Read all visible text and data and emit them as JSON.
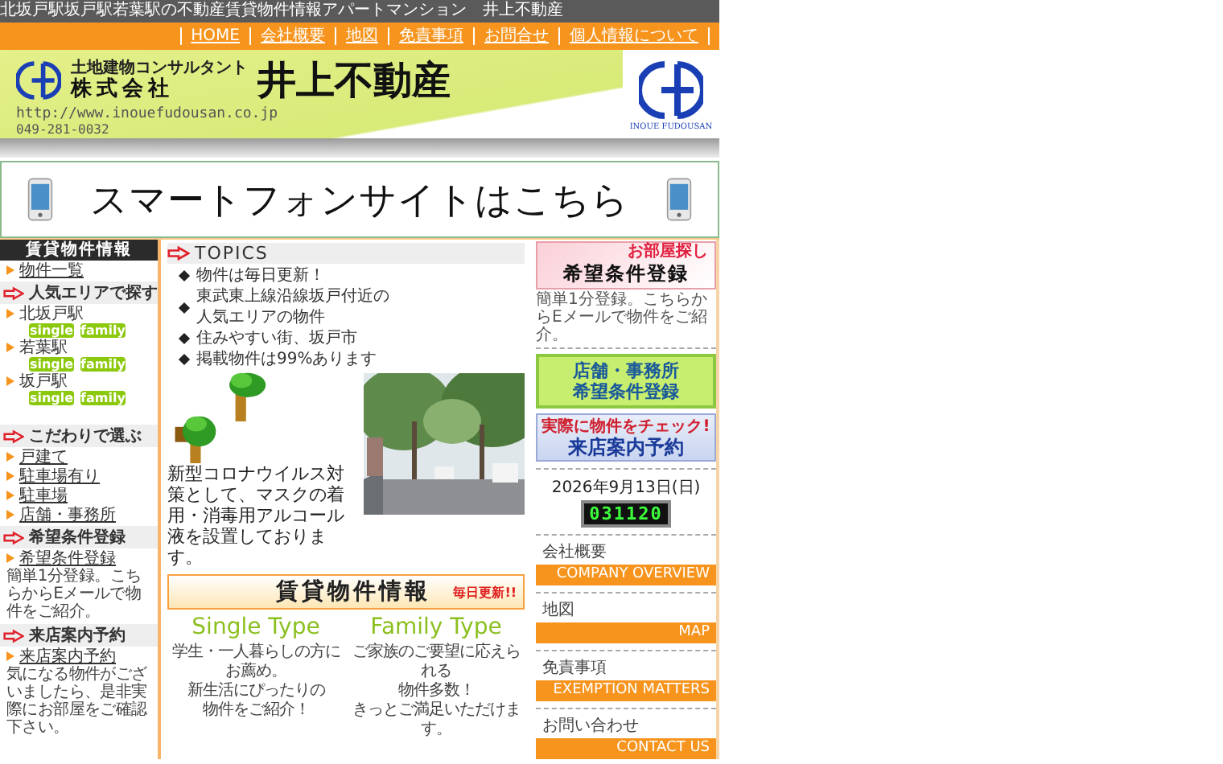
{
  "title_bar": "北坂戸駅坂戸駅若葉駅の不動産賃貸物件情報アパートマンション　井上不動産",
  "nav": [
    "HOME",
    "会社概要",
    "地図",
    "免責事項",
    "お問合せ",
    "個人情報について"
  ],
  "header": {
    "tagline": "土地建物コンサルタント",
    "company_type": "株式会社",
    "company_name": "井上不動産",
    "url": "http://www.inouefudousan.co.jp",
    "phone": "049-281-0032",
    "logo_caption": "INOUE FUDOUSAN"
  },
  "smartphone_banner": "スマートフォンサイトはこちら",
  "sidebar": [
    {
      "kind": "title",
      "text": "賃貸物件情報"
    },
    {
      "kind": "link",
      "text": "物件一覧"
    },
    {
      "kind": "heading",
      "text": "人気エリアで探す"
    },
    {
      "kind": "station",
      "text": "北坂戸駅",
      "tags": [
        "single",
        "family"
      ]
    },
    {
      "kind": "station",
      "text": "若葉駅",
      "tags": [
        "single",
        "family"
      ]
    },
    {
      "kind": "station",
      "text": "坂戸駅",
      "tags": [
        "single",
        "family"
      ]
    },
    {
      "kind": "heading",
      "text": "こだわりで選ぶ"
    },
    {
      "kind": "link",
      "text": "戸建て"
    },
    {
      "kind": "link",
      "text": "駐車場有り"
    },
    {
      "kind": "link",
      "text": "駐車場"
    },
    {
      "kind": "link",
      "text": "店舗・事務所"
    },
    {
      "kind": "heading",
      "text": "希望条件登録"
    },
    {
      "kind": "link",
      "text": "希望条件登録"
    },
    {
      "kind": "note",
      "text": "簡単1分登録。こちらからEメールで物件をご紹介。"
    },
    {
      "kind": "heading",
      "text": "来店案内予約"
    },
    {
      "kind": "link",
      "text": "来店案内予約"
    },
    {
      "kind": "note",
      "text": "気になる物件がございましたら、是非実際にお部屋をご確認下さい。"
    }
  ],
  "topics": {
    "heading": "TOPICS",
    "items": [
      [
        "物件は毎日更新！"
      ],
      [
        "東武東上線沿線坂戸付近の",
        "人気エリアの物件"
      ],
      [
        "住みやすい街、坂戸市"
      ],
      [
        "掲載物件は99%あります"
      ]
    ]
  },
  "notice": "新型コロナウイルス対策として、マスクの着用・消毒用アルコール液を設置しております。",
  "rental": {
    "title": "賃貸物件情報",
    "badge": "毎日更新!!",
    "types": [
      {
        "title": "Single Type",
        "lines": [
          "学生・一人暮らしの方にお薦め。",
          "新生活にぴったりの",
          "物件をご紹介！"
        ]
      },
      {
        "title": "Family Type",
        "lines": [
          "ご家族のご要望に応えられる",
          "物件多数！",
          "きっとご満足いただけます。"
        ]
      }
    ]
  },
  "right": {
    "banners": [
      {
        "kind": "envelope",
        "small": "お部屋探し",
        "big": "希望条件登録",
        "note": "簡単1分登録。こちらからEメールで物件をご紹介。"
      },
      {
        "kind": "green",
        "lines": [
          "店舗・事務所",
          "希望条件登録"
        ]
      },
      {
        "kind": "blue",
        "small": "実際に物件をチェック!",
        "big": "来店案内予約"
      }
    ],
    "date": "2026年9月13日(日)",
    "clock": "031120",
    "links": [
      {
        "label": "会社概要",
        "banner": "COMPANY OVERVIEW"
      },
      {
        "label": "地図",
        "banner": "MAP"
      },
      {
        "label": "免責事項",
        "banner": "EXEMPTION MATTERS"
      },
      {
        "label": "お問い合わせ",
        "banner": "CONTACT US"
      }
    ]
  }
}
